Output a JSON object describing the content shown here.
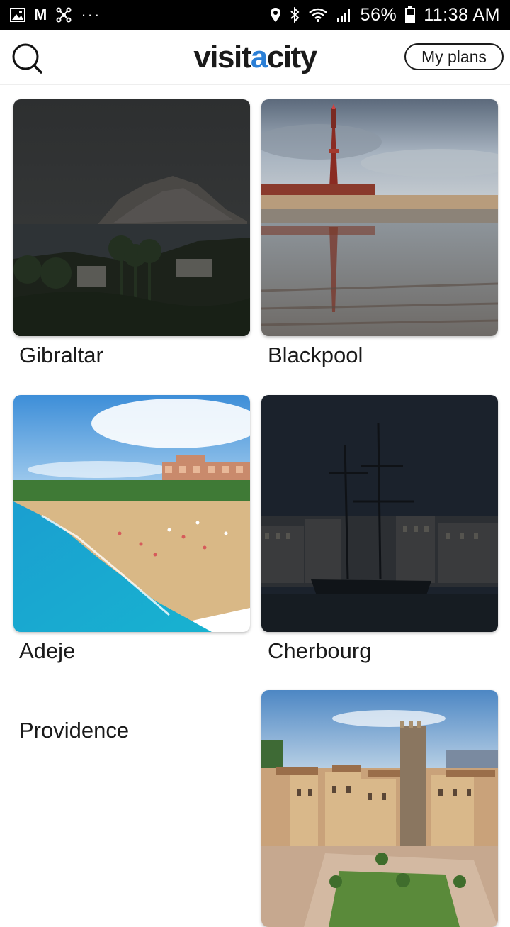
{
  "status_bar": {
    "battery": "56%",
    "time": "11:38 AM",
    "left_icons": [
      "gallery-icon",
      "gmail-icon",
      "network-icon",
      "more-dots-icon"
    ],
    "right_icons": [
      "location-icon",
      "bluetooth-icon",
      "wifi-icon",
      "signal-icon",
      "battery-icon"
    ]
  },
  "header": {
    "logo_prefix": "visit",
    "logo_accent": "a",
    "logo_suffix": "city",
    "my_plans_label": "My plans",
    "accent_color": "#2b7fd6"
  },
  "cities": [
    {
      "name": "Gibraltar"
    },
    {
      "name": "Blackpool"
    },
    {
      "name": "Adeje"
    },
    {
      "name": "Cherbourg"
    },
    {
      "name": "Providence"
    },
    {
      "name": ""
    }
  ]
}
